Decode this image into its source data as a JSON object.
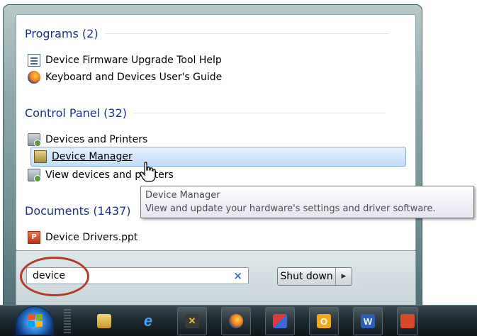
{
  "start_menu": {
    "groups": {
      "programs": {
        "header": "Programs (2)",
        "items": [
          {
            "label": "Device Firmware Upgrade Tool Help",
            "icon": "help-document-icon"
          },
          {
            "label": "Keyboard and Devices User's Guide",
            "icon": "firefox-icon"
          }
        ]
      },
      "control_panel": {
        "header": "Control Panel (32)",
        "items": [
          {
            "label": "Devices and Printers",
            "icon": "printer-icon"
          },
          {
            "label": "Device Manager",
            "icon": "device-manager-icon",
            "selected": true
          },
          {
            "label": "View devices and printers",
            "icon": "printer-icon"
          }
        ]
      },
      "documents": {
        "header": "Documents (1437)",
        "items": [
          {
            "label": "Device Drivers.ppt",
            "icon": "powerpoint-icon"
          }
        ]
      }
    },
    "tooltip": {
      "title": "Device Manager",
      "description": "View and update your hardware's settings and driver software."
    },
    "search": {
      "value": "device",
      "clear_glyph": "×"
    },
    "shutdown": {
      "label": "Shut down",
      "arrow_glyph": "▶"
    }
  },
  "taskbar": {
    "start_button_icon": "windows-start-orb-icon",
    "buttons": [
      {
        "name": "explorer",
        "icon": "folder-icon"
      },
      {
        "name": "internet-explorer",
        "icon": "ie-icon",
        "glyph": "e"
      },
      {
        "name": "x-app",
        "icon": "x-app-icon",
        "glyph": "✕"
      },
      {
        "name": "firefox",
        "icon": "firefox-icon"
      },
      {
        "name": "paint",
        "icon": "paint-icon"
      },
      {
        "name": "outlook",
        "icon": "outlook-icon",
        "glyph": "O"
      },
      {
        "name": "word",
        "icon": "word-icon",
        "glyph": "W"
      }
    ]
  },
  "colors": {
    "header_blue": "#1e3287",
    "selection_border": "#84acdd",
    "annotation_circle": "#b23c2a"
  }
}
